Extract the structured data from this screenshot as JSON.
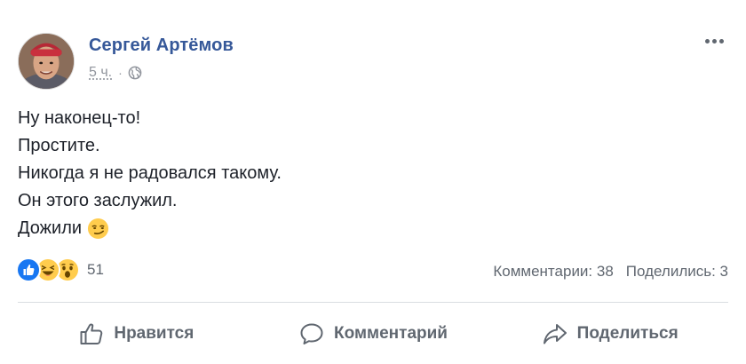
{
  "post": {
    "author": "Сергей Артёмов",
    "time": "5 ч.",
    "separator": "·",
    "privacy_icon": "globe-icon",
    "menu_icon": "more-dots-icon",
    "lines": [
      "Ну наконец-то!",
      "Простите.",
      "Никогда я не радовался такому.",
      "Он этого заслужил.",
      "Дожили"
    ],
    "trailing_emoji": "smirking-face-emoji"
  },
  "reactions": {
    "icons": [
      "like-reaction-icon",
      "haha-reaction-icon",
      "wow-reaction-icon"
    ],
    "count": "51"
  },
  "counts": {
    "comments": "Комментарии: 38",
    "shares": "Поделились: 3"
  },
  "actions": {
    "like": "Нравится",
    "comment": "Комментарий",
    "share": "Поделиться"
  },
  "colors": {
    "author": "#365899",
    "muted": "#606770",
    "meta": "#90949c",
    "like_blue": "#1877f2",
    "emoji_yellow": "#ffcc4d",
    "divider": "#dadde1"
  }
}
